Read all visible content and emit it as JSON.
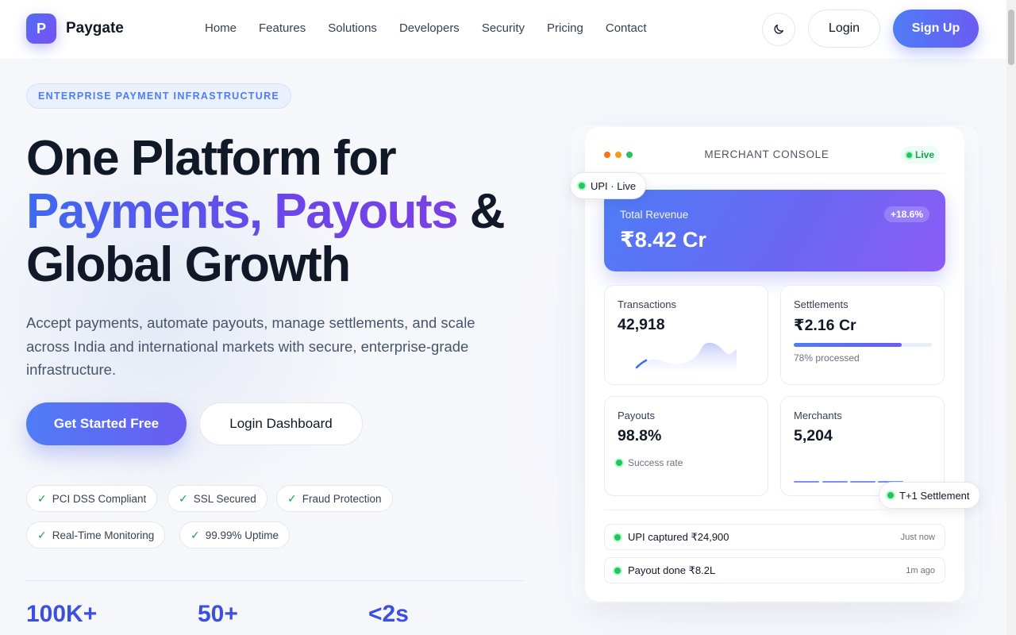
{
  "brand": {
    "logo_letter": "P",
    "name": "Paygate",
    "primary_color": "#4f7cf7",
    "accent_color": "#6a5cf2"
  },
  "nav": {
    "links": [
      "Home",
      "Features",
      "Solutions",
      "Developers",
      "Security",
      "Pricing",
      "Contact"
    ],
    "theme_icon": "moon-icon",
    "login_label": "Login",
    "signup_label": "Sign Up"
  },
  "hero": {
    "eyebrow": "ENTERPRISE PAYMENT INFRASTRUCTURE",
    "headline_line1": "One Platform for",
    "headline_payments": "Payments, Payouts",
    "headline_amp": " &",
    "headline_line3": "Global Growth",
    "subtitle": "Accept payments, automate payouts, manage settlements, and scale across India and international markets with secure, enterprise-grade infrastructure.",
    "cta_primary": "Get Started Free",
    "cta_secondary": "Login Dashboard",
    "badges": [
      "PCI DSS Compliant",
      "SSL Secured",
      "Fraud Protection",
      "Real-Time Monitoring",
      "99.99% Uptime"
    ],
    "check_glyph": "✓",
    "stats": [
      "100K+",
      "50+",
      "<2s"
    ]
  },
  "console": {
    "title": "MERCHANT CONSOLE",
    "live_label": "Live",
    "window_dot_colors": [
      "#f97316",
      "#f59e0b",
      "#22c55e"
    ],
    "float_upi": "UPI · Live",
    "float_settlement": "T+1 Settlement",
    "revenue": {
      "label": "Total Revenue",
      "value": "₹8.42 Cr",
      "change": "+18.6%"
    },
    "transactions": {
      "label": "Transactions",
      "value": "42,918"
    },
    "settlements": {
      "label": "Settlements",
      "value": "₹2.16 Cr",
      "progress": 0.78,
      "note": "78% processed"
    },
    "payouts": {
      "label": "Payouts",
      "value": "98.8%",
      "note": "Success rate"
    },
    "merchants": {
      "label": "Merchants",
      "value": "5,204"
    },
    "feed": [
      {
        "text": "UPI captured ₹24,900",
        "time": "Just now"
      },
      {
        "text": "Payout done ₹8.2L",
        "time": "1m ago"
      }
    ]
  }
}
